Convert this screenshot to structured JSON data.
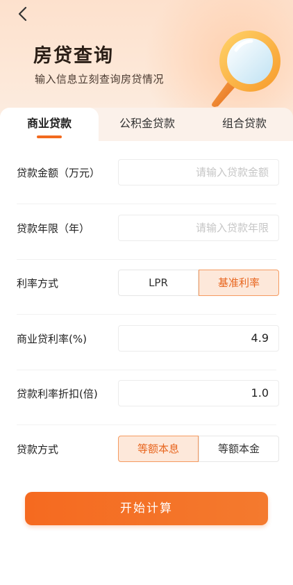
{
  "header": {
    "title": "房贷查询",
    "subtitle": "输入信息立刻查询房贷情况"
  },
  "tabs": [
    {
      "label": "商业贷款",
      "active": true
    },
    {
      "label": "公积金贷款",
      "active": false
    },
    {
      "label": "组合贷款",
      "active": false
    }
  ],
  "form": {
    "loan_amount": {
      "label": "贷款金额（万元）",
      "placeholder": "请输入贷款金额",
      "value": ""
    },
    "loan_term": {
      "label": "贷款年限（年）",
      "placeholder": "请输入贷款年限",
      "value": ""
    },
    "rate_method": {
      "label": "利率方式",
      "options": [
        "LPR",
        "基准利率"
      ],
      "selected": "基准利率"
    },
    "commercial_rate": {
      "label": "商业贷利率(%)",
      "value": "4.9"
    },
    "rate_discount": {
      "label": "贷款利率折扣(倍)",
      "value": "1.0"
    },
    "repay_method": {
      "label": "贷款方式",
      "options": [
        "等额本息",
        "等额本金"
      ],
      "selected": "等额本息"
    }
  },
  "submit_label": "开始计算",
  "colors": {
    "accent": "#f26a1e",
    "selected_bg": "#fde8da",
    "header_bg": "#fde1cd"
  },
  "icons": {
    "back": "chevron-left-icon",
    "magnifier": "magnifier-icon"
  }
}
